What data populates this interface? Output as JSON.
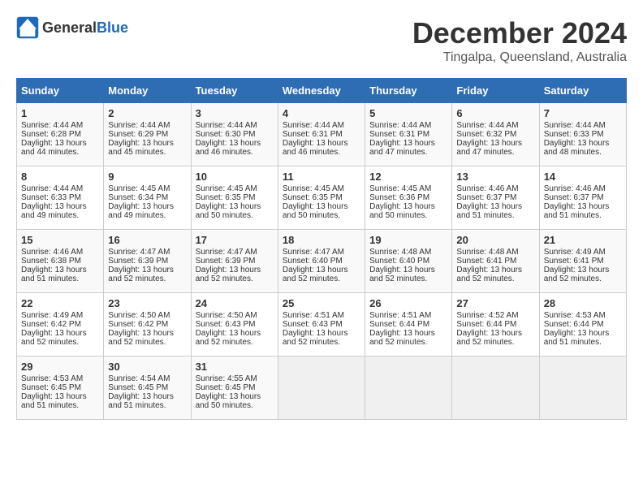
{
  "logo": {
    "general": "General",
    "blue": "Blue"
  },
  "title": "December 2024",
  "location": "Tingalpa, Queensland, Australia",
  "days_of_week": [
    "Sunday",
    "Monday",
    "Tuesday",
    "Wednesday",
    "Thursday",
    "Friday",
    "Saturday"
  ],
  "weeks": [
    [
      {
        "day": "1",
        "sunrise": "Sunrise: 4:44 AM",
        "sunset": "Sunset: 6:28 PM",
        "daylight": "Daylight: 13 hours and 44 minutes."
      },
      {
        "day": "2",
        "sunrise": "Sunrise: 4:44 AM",
        "sunset": "Sunset: 6:29 PM",
        "daylight": "Daylight: 13 hours and 45 minutes."
      },
      {
        "day": "3",
        "sunrise": "Sunrise: 4:44 AM",
        "sunset": "Sunset: 6:30 PM",
        "daylight": "Daylight: 13 hours and 46 minutes."
      },
      {
        "day": "4",
        "sunrise": "Sunrise: 4:44 AM",
        "sunset": "Sunset: 6:31 PM",
        "daylight": "Daylight: 13 hours and 46 minutes."
      },
      {
        "day": "5",
        "sunrise": "Sunrise: 4:44 AM",
        "sunset": "Sunset: 6:31 PM",
        "daylight": "Daylight: 13 hours and 47 minutes."
      },
      {
        "day": "6",
        "sunrise": "Sunrise: 4:44 AM",
        "sunset": "Sunset: 6:32 PM",
        "daylight": "Daylight: 13 hours and 47 minutes."
      },
      {
        "day": "7",
        "sunrise": "Sunrise: 4:44 AM",
        "sunset": "Sunset: 6:33 PM",
        "daylight": "Daylight: 13 hours and 48 minutes."
      }
    ],
    [
      {
        "day": "8",
        "sunrise": "Sunrise: 4:44 AM",
        "sunset": "Sunset: 6:33 PM",
        "daylight": "Daylight: 13 hours and 49 minutes."
      },
      {
        "day": "9",
        "sunrise": "Sunrise: 4:45 AM",
        "sunset": "Sunset: 6:34 PM",
        "daylight": "Daylight: 13 hours and 49 minutes."
      },
      {
        "day": "10",
        "sunrise": "Sunrise: 4:45 AM",
        "sunset": "Sunset: 6:35 PM",
        "daylight": "Daylight: 13 hours and 50 minutes."
      },
      {
        "day": "11",
        "sunrise": "Sunrise: 4:45 AM",
        "sunset": "Sunset: 6:35 PM",
        "daylight": "Daylight: 13 hours and 50 minutes."
      },
      {
        "day": "12",
        "sunrise": "Sunrise: 4:45 AM",
        "sunset": "Sunset: 6:36 PM",
        "daylight": "Daylight: 13 hours and 50 minutes."
      },
      {
        "day": "13",
        "sunrise": "Sunrise: 4:46 AM",
        "sunset": "Sunset: 6:37 PM",
        "daylight": "Daylight: 13 hours and 51 minutes."
      },
      {
        "day": "14",
        "sunrise": "Sunrise: 4:46 AM",
        "sunset": "Sunset: 6:37 PM",
        "daylight": "Daylight: 13 hours and 51 minutes."
      }
    ],
    [
      {
        "day": "15",
        "sunrise": "Sunrise: 4:46 AM",
        "sunset": "Sunset: 6:38 PM",
        "daylight": "Daylight: 13 hours and 51 minutes."
      },
      {
        "day": "16",
        "sunrise": "Sunrise: 4:47 AM",
        "sunset": "Sunset: 6:39 PM",
        "daylight": "Daylight: 13 hours and 52 minutes."
      },
      {
        "day": "17",
        "sunrise": "Sunrise: 4:47 AM",
        "sunset": "Sunset: 6:39 PM",
        "daylight": "Daylight: 13 hours and 52 minutes."
      },
      {
        "day": "18",
        "sunrise": "Sunrise: 4:47 AM",
        "sunset": "Sunset: 6:40 PM",
        "daylight": "Daylight: 13 hours and 52 minutes."
      },
      {
        "day": "19",
        "sunrise": "Sunrise: 4:48 AM",
        "sunset": "Sunset: 6:40 PM",
        "daylight": "Daylight: 13 hours and 52 minutes."
      },
      {
        "day": "20",
        "sunrise": "Sunrise: 4:48 AM",
        "sunset": "Sunset: 6:41 PM",
        "daylight": "Daylight: 13 hours and 52 minutes."
      },
      {
        "day": "21",
        "sunrise": "Sunrise: 4:49 AM",
        "sunset": "Sunset: 6:41 PM",
        "daylight": "Daylight: 13 hours and 52 minutes."
      }
    ],
    [
      {
        "day": "22",
        "sunrise": "Sunrise: 4:49 AM",
        "sunset": "Sunset: 6:42 PM",
        "daylight": "Daylight: 13 hours and 52 minutes."
      },
      {
        "day": "23",
        "sunrise": "Sunrise: 4:50 AM",
        "sunset": "Sunset: 6:42 PM",
        "daylight": "Daylight: 13 hours and 52 minutes."
      },
      {
        "day": "24",
        "sunrise": "Sunrise: 4:50 AM",
        "sunset": "Sunset: 6:43 PM",
        "daylight": "Daylight: 13 hours and 52 minutes."
      },
      {
        "day": "25",
        "sunrise": "Sunrise: 4:51 AM",
        "sunset": "Sunset: 6:43 PM",
        "daylight": "Daylight: 13 hours and 52 minutes."
      },
      {
        "day": "26",
        "sunrise": "Sunrise: 4:51 AM",
        "sunset": "Sunset: 6:44 PM",
        "daylight": "Daylight: 13 hours and 52 minutes."
      },
      {
        "day": "27",
        "sunrise": "Sunrise: 4:52 AM",
        "sunset": "Sunset: 6:44 PM",
        "daylight": "Daylight: 13 hours and 52 minutes."
      },
      {
        "day": "28",
        "sunrise": "Sunrise: 4:53 AM",
        "sunset": "Sunset: 6:44 PM",
        "daylight": "Daylight: 13 hours and 51 minutes."
      }
    ],
    [
      {
        "day": "29",
        "sunrise": "Sunrise: 4:53 AM",
        "sunset": "Sunset: 6:45 PM",
        "daylight": "Daylight: 13 hours and 51 minutes."
      },
      {
        "day": "30",
        "sunrise": "Sunrise: 4:54 AM",
        "sunset": "Sunset: 6:45 PM",
        "daylight": "Daylight: 13 hours and 51 minutes."
      },
      {
        "day": "31",
        "sunrise": "Sunrise: 4:55 AM",
        "sunset": "Sunset: 6:45 PM",
        "daylight": "Daylight: 13 hours and 50 minutes."
      },
      null,
      null,
      null,
      null
    ]
  ]
}
